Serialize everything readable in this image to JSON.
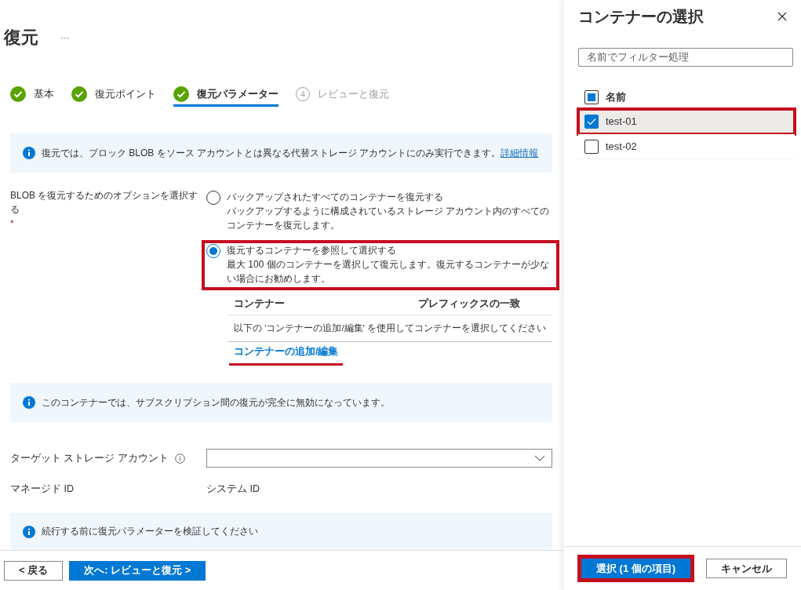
{
  "page": {
    "title": "復元",
    "more": "···"
  },
  "steps": [
    {
      "label": "基本",
      "completed": true,
      "selected": false
    },
    {
      "label": "復元ポイント",
      "completed": true,
      "selected": false
    },
    {
      "label": "復元パラメーター",
      "completed": true,
      "selected": true
    },
    {
      "label": "レビューと復元",
      "completed": false,
      "number": "4",
      "selected": false
    }
  ],
  "info_top": {
    "text": "復元では、ブロック BLOB をソース アカウントとは異なる代替ストレージ アカウントにのみ実行できます。",
    "link": "詳細情報"
  },
  "restore_option": {
    "label": "BLOB を復元するためのオプションを選択する",
    "required_mark": "*",
    "options": [
      {
        "title": "バックアップされたすべてのコンテナーを復元する",
        "description": "バックアップするように構成されているストレージ アカウント内のすべてのコンテナーを復元します。",
        "selected": false,
        "highlighted": false
      },
      {
        "title": "復元するコンテナーを参照して選択する",
        "description": "最大 100 個のコンテナーを選択して復元します。復元するコンテナーが少ない場合にお勧めします。",
        "selected": true,
        "highlighted": true
      }
    ]
  },
  "container_table": {
    "columns": [
      "コンテナー",
      "プレフィックスの一致"
    ],
    "empty_text": "以下の 'コンテナーの追加/編集' を使用してコンテナーを選択してください",
    "add_link": "コンテナーの追加/編集",
    "add_link_underlined": true
  },
  "info_middle": {
    "text": "このコンテナーでは、サブスクリプション間の復元が完全に無効になっています。"
  },
  "target_account": {
    "label": "ターゲット ストレージ アカウント"
  },
  "managed_id": {
    "label": "マネージド ID",
    "value": "システム ID"
  },
  "info_bottom": {
    "text": "続行する前に復元パラメーターを検証してください"
  },
  "footer": {
    "back": "< 戻る",
    "next": "次へ: レビューと復元 >"
  },
  "panel": {
    "title": "コンテナーの選択",
    "filter": {
      "placeholder": "名前でフィルター処理"
    },
    "header": {
      "label": "名前",
      "indeterminate": true
    },
    "rows": [
      {
        "name": "test-01",
        "checked": true,
        "selected": true,
        "highlighted": true
      },
      {
        "name": "test-02",
        "checked": false,
        "selected": false,
        "highlighted": false
      }
    ],
    "select_button": {
      "label": "選択 (1 個の項目)",
      "highlighted": true
    },
    "cancel_button": "キャンセル"
  }
}
